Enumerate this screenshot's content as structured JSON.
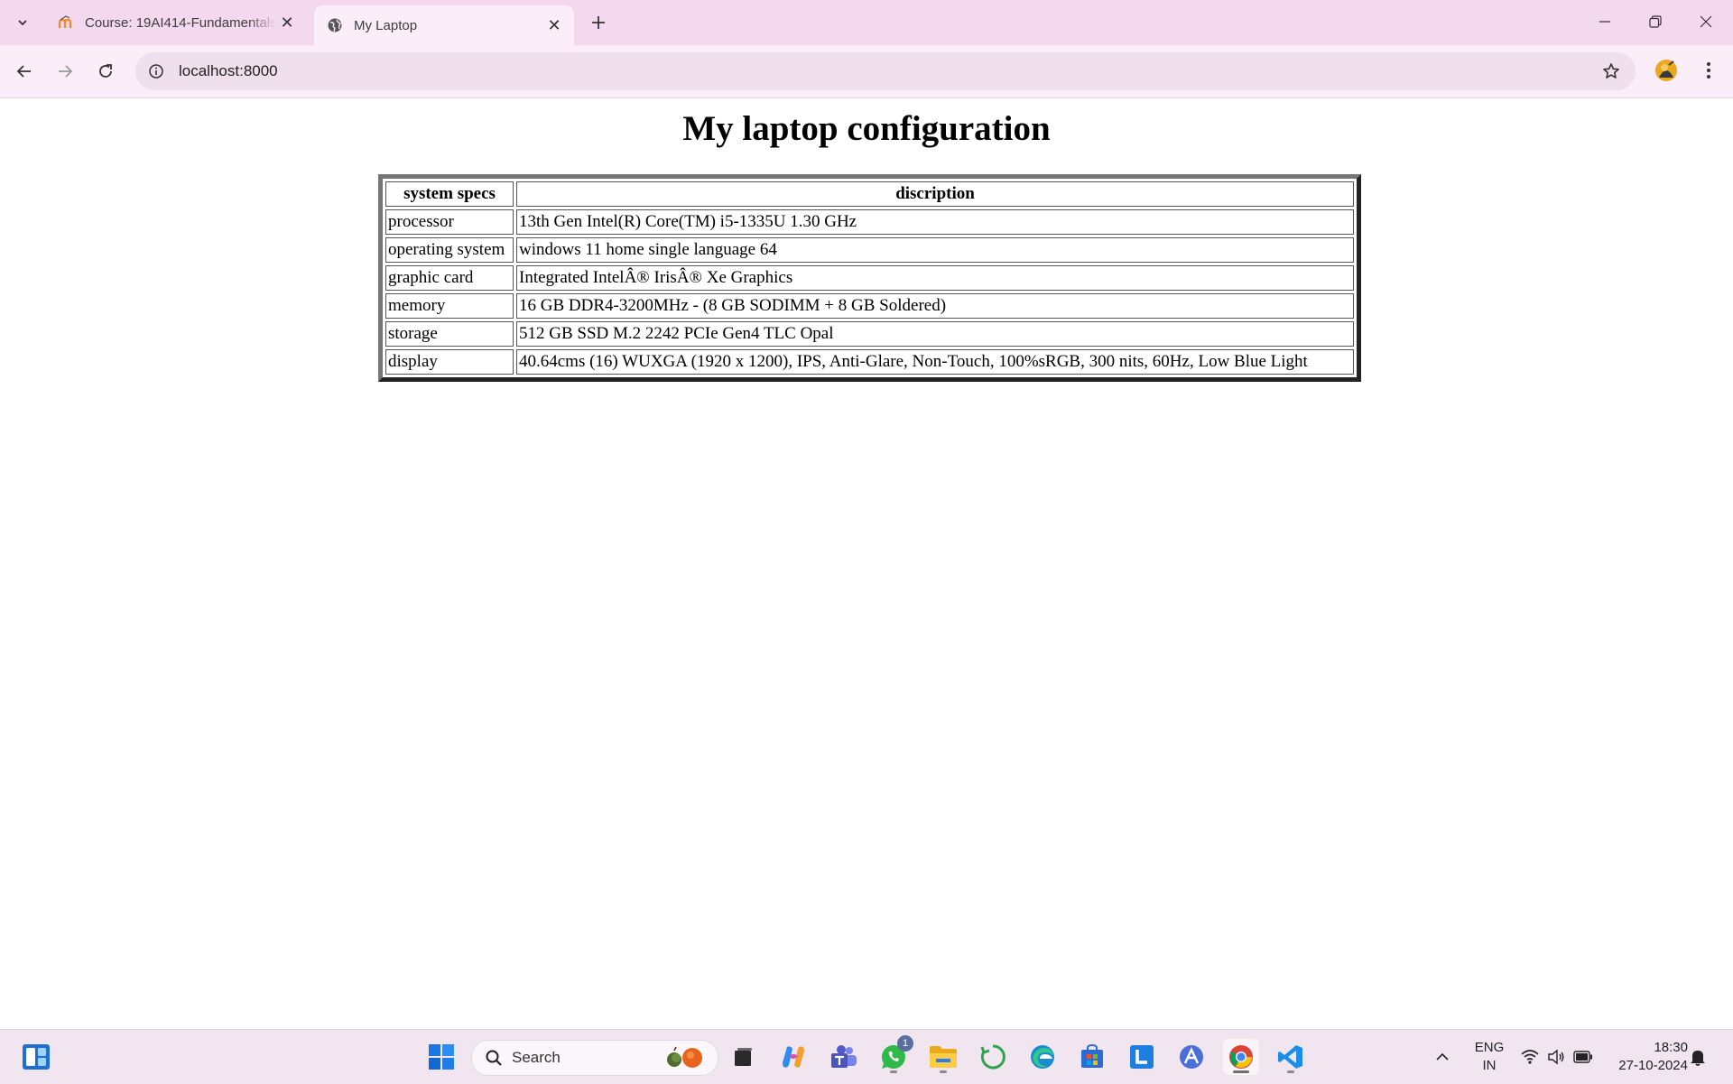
{
  "browser": {
    "tabs": [
      {
        "title": "Course: 19AI414-Fundamentals of Web...",
        "active": false
      },
      {
        "title": "My Laptop",
        "active": true
      }
    ],
    "address": "localhost:8000"
  },
  "page": {
    "heading": "My laptop configuration",
    "table": {
      "headers": [
        "system specs",
        "discription"
      ],
      "rows": [
        [
          "processor",
          "13th Gen Intel(R) Core(TM) i5-1335U 1.30 GHz"
        ],
        [
          "operating system",
          "windows 11 home single language 64"
        ],
        [
          "graphic card",
          "Integrated IntelÂ® IrisÂ® Xe Graphics"
        ],
        [
          "memory",
          "16 GB DDR4-3200MHz - (8 GB SODIMM + 8 GB Soldered)"
        ],
        [
          "storage",
          "512 GB SSD M.2 2242 PCIe Gen4 TLC Opal"
        ],
        [
          "display",
          "40.64cms (16) WUXGA (1920 x 1200), IPS, Anti-Glare, Non-Touch, 100%sRGB, 300 nits, 60Hz, Low Blue Light"
        ]
      ]
    }
  },
  "taskbar": {
    "search_label": "Search",
    "whatsapp_badge": "1",
    "language": {
      "line1": "ENG",
      "line2": "IN"
    },
    "clock": {
      "time": "18:30",
      "date": "27-10-2024"
    }
  }
}
